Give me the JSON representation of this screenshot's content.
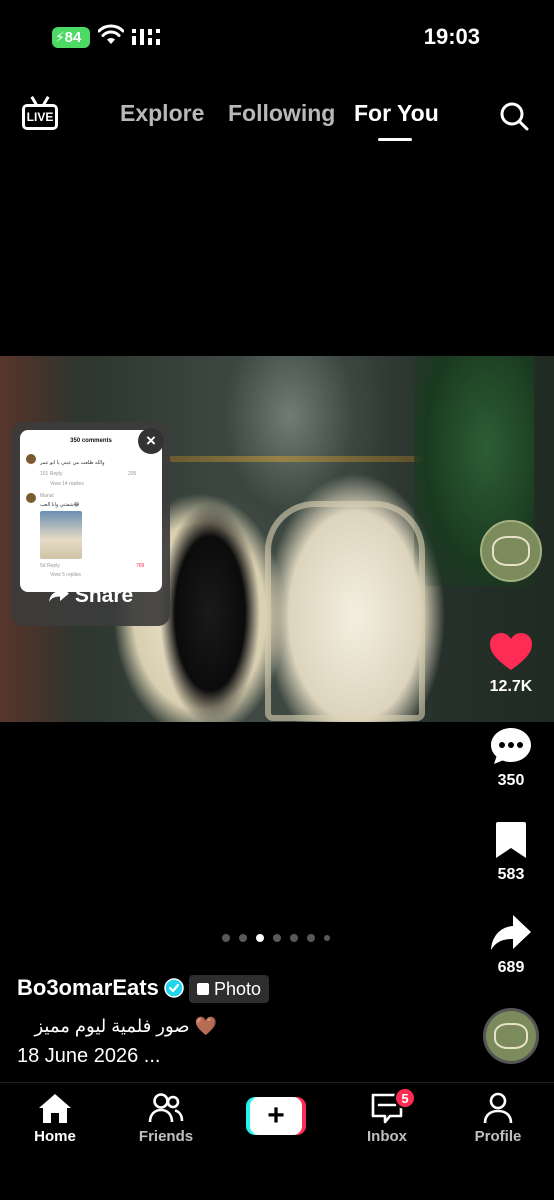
{
  "status_bar": {
    "battery": "84",
    "time": "19:03"
  },
  "top_nav": {
    "live_label": "LIVE",
    "tabs": [
      {
        "label": "Explore",
        "active": false
      },
      {
        "label": "Following",
        "active": false
      },
      {
        "label": "For You",
        "active": true
      }
    ]
  },
  "share_popup": {
    "label": "Share",
    "close_label": "×",
    "preview": {
      "comments_header": "350 comments",
      "comment_1_text": "والله طلعت من عيني يا ابو عمر",
      "comment_1_meta": "101   Reply",
      "comment_1_likes": "205",
      "view_replies_1": "View 14 replies",
      "comment_2_user": "Manal",
      "comment_2_text": "شفتني وانا العب😂",
      "comment_2_meta": "5d   Reply",
      "comment_2_likes": "769",
      "view_replies_2": "View 5 replies"
    }
  },
  "right_rail": {
    "likes": "12.7K",
    "comments": "350",
    "bookmarks": "583",
    "shares": "689"
  },
  "pagination": {
    "total": 7,
    "active_index": 2
  },
  "caption": {
    "username": "Bo3omarEats",
    "badge_label": "Photo",
    "text": "🤎 صور فلمية ليوم مميز",
    "date": "18 June 2026 ..."
  },
  "bottom_nav": {
    "items": [
      {
        "label": "Home",
        "active": true
      },
      {
        "label": "Friends",
        "active": false
      },
      {
        "label": "Inbox",
        "active": false
      },
      {
        "label": "Profile",
        "active": false
      }
    ],
    "inbox_badge": "5"
  },
  "colors": {
    "like_red": "#fe2c55",
    "verified_blue": "#20d5ec",
    "battery_green": "#4cd964"
  }
}
